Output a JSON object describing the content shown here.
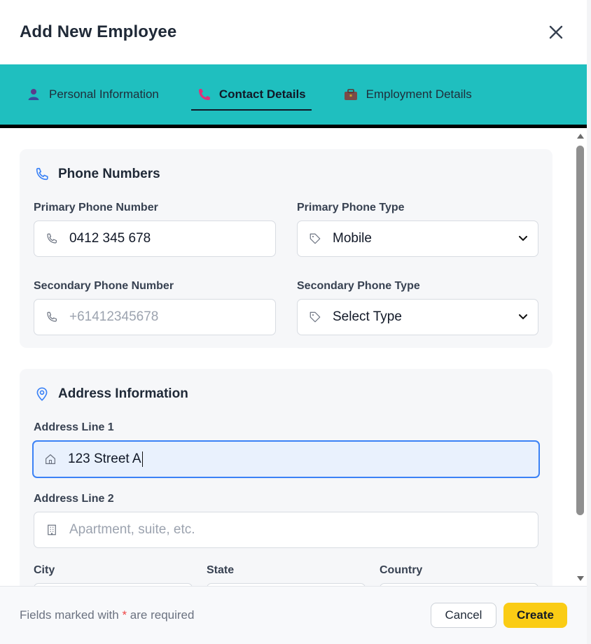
{
  "dialog": {
    "title": "Add New Employee"
  },
  "tabs": [
    {
      "label": "Personal Information",
      "icon": "person-icon",
      "active": false
    },
    {
      "label": "Contact Details",
      "icon": "phone-icon",
      "active": true
    },
    {
      "label": "Employment Details",
      "icon": "briefcase-icon",
      "active": false
    }
  ],
  "phone_section": {
    "title": "Phone Numbers",
    "primary_phone": {
      "label": "Primary Phone Number",
      "value": "0412 345 678",
      "placeholder": ""
    },
    "primary_type": {
      "label": "Primary Phone Type",
      "value": "Mobile"
    },
    "secondary_phone": {
      "label": "Secondary Phone Number",
      "value": "",
      "placeholder": "+61412345678"
    },
    "secondary_type": {
      "label": "Secondary Phone Type",
      "value": "Select Type"
    }
  },
  "address_section": {
    "title": "Address Information",
    "line1": {
      "label": "Address Line 1",
      "value": "123 Street A"
    },
    "line2": {
      "label": "Address Line 2",
      "value": "",
      "placeholder": "Apartment, suite, etc."
    },
    "city": {
      "label": "City"
    },
    "state": {
      "label": "State"
    },
    "country": {
      "label": "Country"
    }
  },
  "footer": {
    "note_before": "Fields marked with ",
    "note_star": "*",
    "note_after": " are required",
    "cancel_label": "Cancel",
    "create_label": "Create"
  },
  "colors": {
    "tab_bar": "#1fbfbf",
    "accent_blue": "#3b82f6",
    "create_button": "#facc15",
    "required_star": "#ef4444"
  }
}
